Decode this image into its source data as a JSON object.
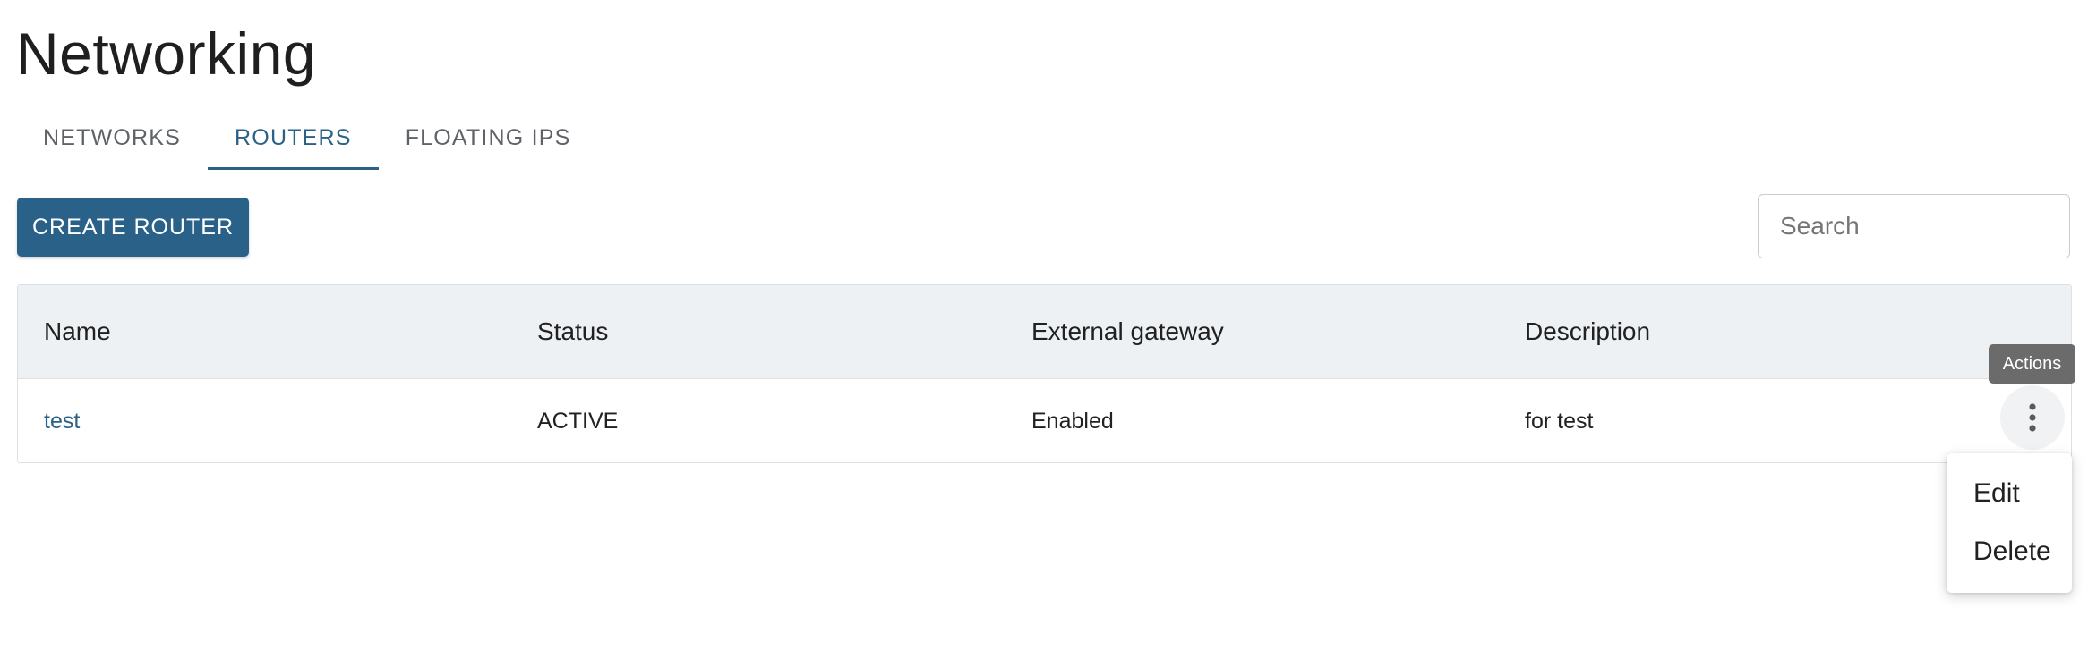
{
  "page": {
    "title": "Networking"
  },
  "tabs": [
    {
      "label": "NETWORKS",
      "active": false
    },
    {
      "label": "ROUTERS",
      "active": true
    },
    {
      "label": "FLOATING IPS",
      "active": false
    }
  ],
  "toolbar": {
    "create_label": "CREATE ROUTER",
    "search_placeholder": "Search",
    "search_value": ""
  },
  "table": {
    "columns": [
      "Name",
      "Status",
      "External gateway",
      "Description"
    ],
    "rows": [
      {
        "name": "test",
        "status": "ACTIVE",
        "external_gateway": "Enabled",
        "description": "for test"
      }
    ]
  },
  "row_actions": {
    "tooltip": "Actions",
    "icon": "more-vertical-icon",
    "menu": [
      {
        "label": "Edit"
      },
      {
        "label": "Delete"
      }
    ]
  },
  "colors": {
    "primary": "#2a6188",
    "header_bg": "#eef1f4",
    "tooltip_bg": "#6b6b6b"
  }
}
